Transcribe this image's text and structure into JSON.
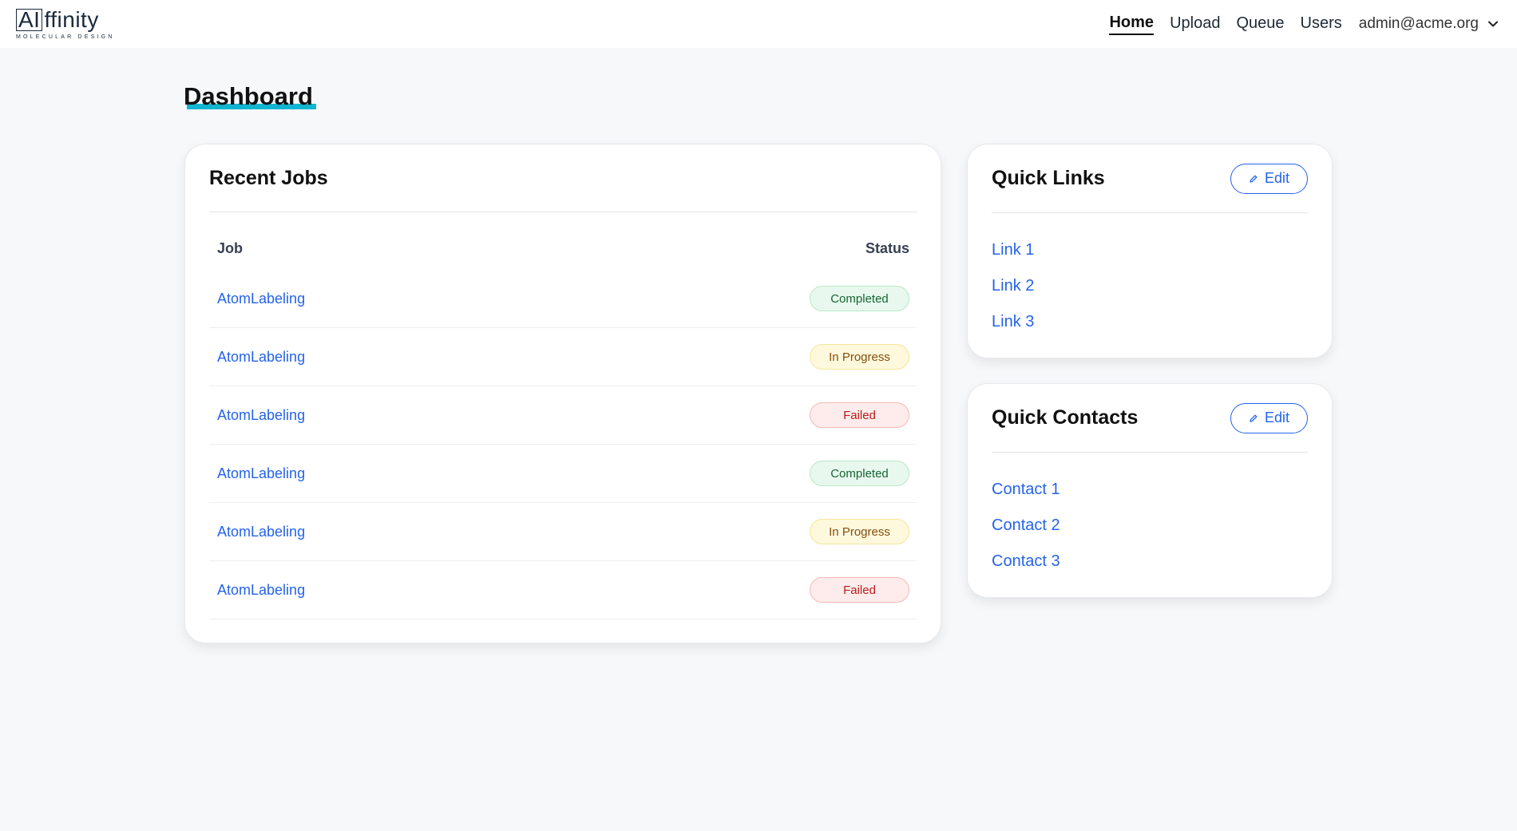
{
  "brand": {
    "logo_ai": "AI",
    "logo_rest": "ffinity",
    "logo_sub": "MOLECULAR DESIGN"
  },
  "nav": {
    "items": [
      {
        "label": "Home",
        "active": true
      },
      {
        "label": "Upload",
        "active": false
      },
      {
        "label": "Queue",
        "active": false
      },
      {
        "label": "Users",
        "active": false
      }
    ],
    "user_email": "admin@acme.org"
  },
  "page": {
    "title": "Dashboard",
    "accent_color": "#10b5d1"
  },
  "recent_jobs": {
    "title": "Recent Jobs",
    "columns": {
      "job": "Job",
      "status": "Status"
    },
    "rows": [
      {
        "job": "AtomLabeling",
        "status": "Completed",
        "status_type": "completed"
      },
      {
        "job": "AtomLabeling",
        "status": "In Progress",
        "status_type": "progress"
      },
      {
        "job": "AtomLabeling",
        "status": "Failed",
        "status_type": "failed"
      },
      {
        "job": "AtomLabeling",
        "status": "Completed",
        "status_type": "completed"
      },
      {
        "job": "AtomLabeling",
        "status": "In Progress",
        "status_type": "progress"
      },
      {
        "job": "AtomLabeling",
        "status": "Failed",
        "status_type": "failed"
      }
    ]
  },
  "quick_links": {
    "title": "Quick Links",
    "edit_label": "Edit",
    "items": [
      "Link 1",
      "Link 2",
      "Link 3"
    ]
  },
  "quick_contacts": {
    "title": "Quick Contacts",
    "edit_label": "Edit",
    "items": [
      "Contact 1",
      "Contact 2",
      "Contact 3"
    ]
  },
  "icons": {
    "edit": "pencil-icon",
    "user_menu": "chevron-down-icon"
  },
  "colors": {
    "link": "#2563eb",
    "completed": "#166534",
    "in_progress": "#854d0e",
    "failed": "#b91c1c"
  }
}
